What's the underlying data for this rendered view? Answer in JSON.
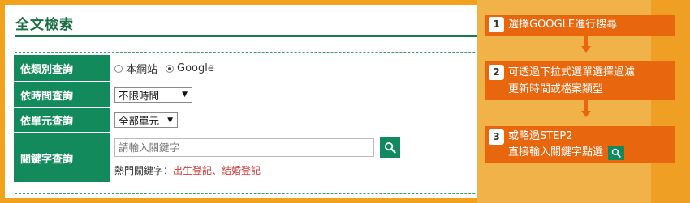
{
  "page": {
    "title": "全文檢索"
  },
  "form": {
    "category_label": "依類別查詢",
    "radio_options": [
      "本網站",
      "Google"
    ],
    "radio_selected": "Google",
    "time_label": "依時間查詢",
    "time_value": "不限時間",
    "unit_label": "依單元查詢",
    "unit_value": "全部單元",
    "keyword_label": "關鍵字查詢",
    "keyword_placeholder": "請輸入關鍵字",
    "hot_prefix": "熱門關鍵字：",
    "hot_links": [
      "出生登記",
      "結婚登記"
    ],
    "hot_separator": "、"
  },
  "steps": [
    {
      "num": "1",
      "lines": [
        "選擇GOOGLE進行搜尋"
      ]
    },
    {
      "num": "2",
      "lines": [
        "可透過下拉式選單選擇過濾",
        "更新時間或檔案類型"
      ]
    },
    {
      "num": "3",
      "lines": [
        "或略過STEP2",
        "直接輸入關鍵字點選"
      ]
    }
  ],
  "icons": {
    "search": "search-icon"
  },
  "colors": {
    "brand_green": "#138a5b",
    "step_orange": "#e8660d",
    "background_orange": "#f0a21c",
    "hot_link_red": "#d23a3a"
  }
}
